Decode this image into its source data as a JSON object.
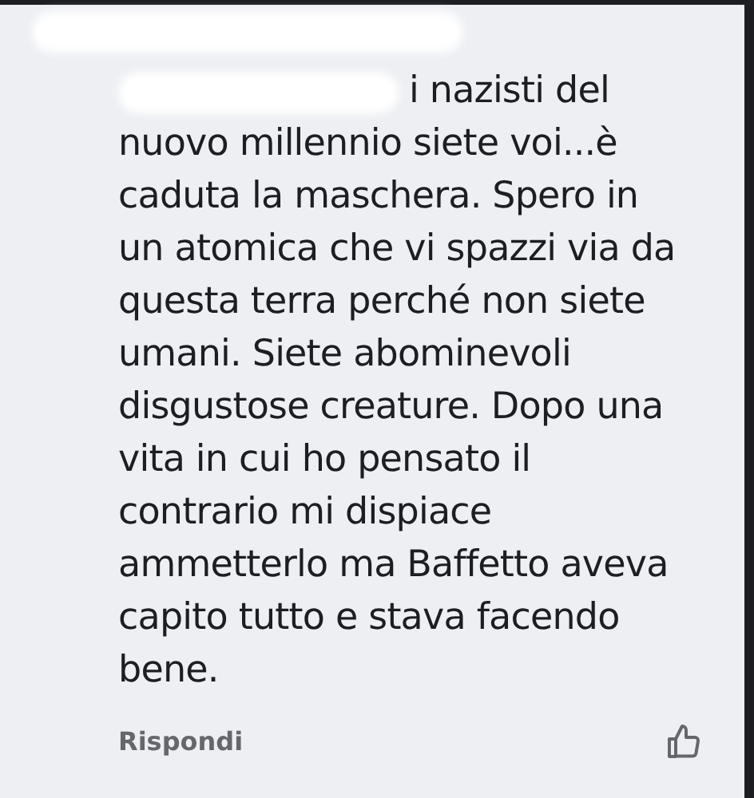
{
  "comment": {
    "author_redacted": true,
    "lines": [
      "i nazisti del",
      "nuovo millennio siete voi...è",
      "caduta la maschera. Spero in",
      "un atomica che vi spazzi via da",
      "questa terra perché non siete",
      "umani. Siete abominevoli",
      "disgustose creature. Dopo una",
      "vita in cui ho pensato il",
      "contrario mi dispiace",
      "ammetterlo ma Baffetto aveva",
      "capito tutto e stava facendo",
      "bene."
    ],
    "reply_label": "Rispondi"
  }
}
